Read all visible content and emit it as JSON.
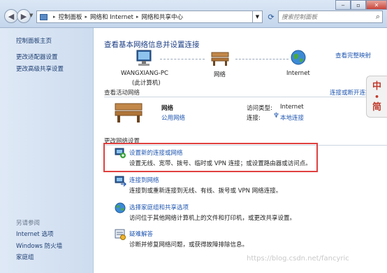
{
  "address_bar": {
    "crumbs": [
      "控制面板",
      "网络和 Internet",
      "网络和共享中心"
    ],
    "search_placeholder": "搜索控制面板"
  },
  "sidebar": {
    "items": [
      "控制面板主页",
      "更改适配器设置",
      "更改高级共享设置"
    ],
    "see_also_label": "另请参阅",
    "see_also": [
      "Internet 选项",
      "Windows 防火墙",
      "家庭组"
    ]
  },
  "main": {
    "title": "查看基本网络信息并设置连接",
    "view_full_map": "查看完整映射",
    "map": {
      "computer_name": "WANGXIANG-PC",
      "computer_sub": "(此计算机)",
      "network": "网络",
      "internet": "Internet"
    },
    "active_networks": {
      "heading": "查看活动网络",
      "connect_link": "连接或断开连接",
      "network_name": "网络",
      "network_type": "公用网络",
      "access_label": "访问类型:",
      "access_value": "Internet",
      "conn_label": "连接:",
      "conn_value": "本地连接"
    },
    "change_settings": {
      "heading": "更改网络设置",
      "items": [
        {
          "title": "设置新的连接或网络",
          "desc": "设置无线、宽带、拨号、临时或 VPN 连接；或设置路由器或访问点。"
        },
        {
          "title": "连接到网络",
          "desc": "连接到或重新连接到无线、有线、拨号或 VPN 网络连接。"
        },
        {
          "title": "选择家庭组和共享选项",
          "desc": "访问位于其他网络计算机上的文件和打印机，或更改共享设置。"
        },
        {
          "title": "疑难解答",
          "desc": "诊断并修复网络问题，或获得故障排除信息。"
        }
      ]
    }
  },
  "ime": {
    "chars": [
      "中",
      "简"
    ]
  },
  "watermark": "https://blog.csdn.net/fancyric",
  "colors": {
    "link": "#1f56b0",
    "title": "#1c3e84",
    "highlight_box": "#e04040"
  }
}
